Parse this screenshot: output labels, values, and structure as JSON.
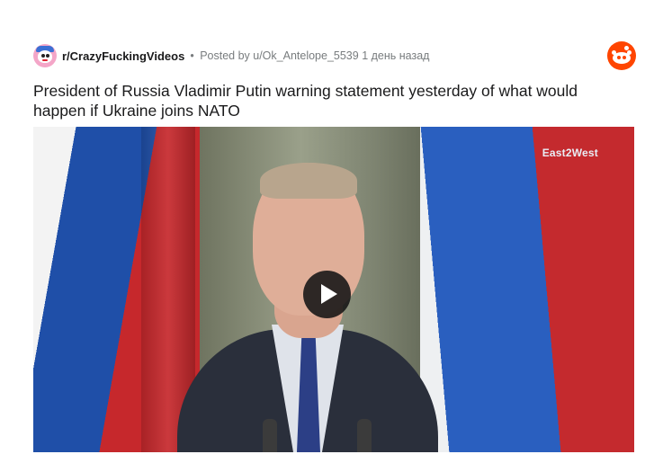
{
  "post": {
    "subreddit": "r/CrazyFuckingVideos",
    "separator": "•",
    "posted_by": "Posted by u/Ok_Antelope_5539",
    "time": "1 день назад",
    "title": "President of Russia Vladimir Putin warning statement yesterday of what would happen if Ukraine joins NATO"
  },
  "video": {
    "watermark": "East2West"
  },
  "icons": {
    "subreddit_avatar": "subreddit-avatar-icon",
    "brand": "reddit-logo-icon",
    "play": "play-icon"
  },
  "colors": {
    "reddit_orange": "#ff4500",
    "meta_gray": "#787c7e",
    "title_text": "#1a1a1b"
  }
}
